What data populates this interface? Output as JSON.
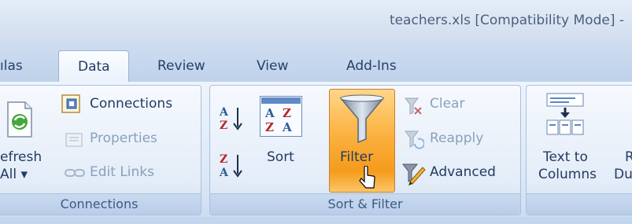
{
  "window": {
    "title": "teachers.xls  [Compatibility Mode] -"
  },
  "tabs": [
    {
      "label": "ılas"
    },
    {
      "label": "Data"
    },
    {
      "label": "Review"
    },
    {
      "label": "View"
    },
    {
      "label": "Add-Ins"
    }
  ],
  "groups": {
    "connections": {
      "label": "Connections",
      "refresh_all_line1": "efresh",
      "refresh_all_line2": "All ▾",
      "connections_label": "Connections",
      "properties_label": "Properties",
      "edit_links_label": "Edit Links"
    },
    "sort_filter": {
      "label": "Sort & Filter",
      "sort_label": "Sort",
      "filter_label": "Filter",
      "clear_label": "Clear",
      "reapply_label": "Reapply",
      "advanced_label": "Advanced"
    },
    "data_tools": {
      "text_to_columns_line1": "Text to",
      "text_to_columns_line2": "Columns",
      "remove_dup_line1": "R",
      "remove_dup_line2": "Du"
    }
  },
  "colors": {
    "accent_orange": "#f5a12a",
    "ribbon_blue": "#dbe7f6",
    "text_blue": "#233b61"
  }
}
